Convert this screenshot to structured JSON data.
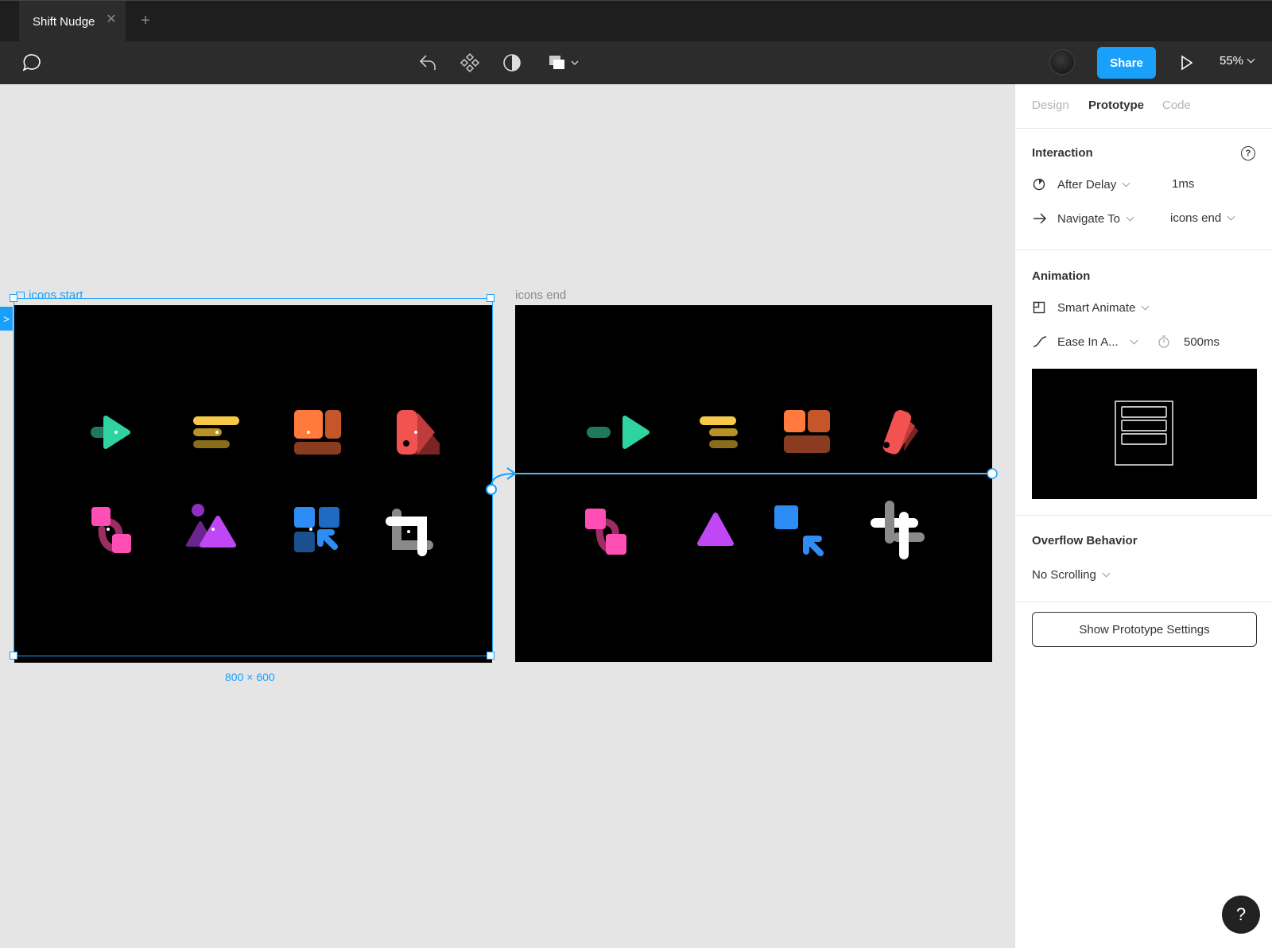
{
  "tabs": {
    "active_tab": "Shift Nudge",
    "close_glyph": "✕",
    "add_glyph": "+"
  },
  "toolbar": {
    "comment_icon": "comment-icon",
    "center_icons": [
      "back-icon",
      "component-icon",
      "mask-contrast-icon",
      "boolean-shapes-icon"
    ],
    "share_label": "Share",
    "zoom_label": "55%"
  },
  "canvas": {
    "frame_start_label": "icons start",
    "frame_end_label": "icons end",
    "dimensions": "800 × 600",
    "flow_start_glyph": ">"
  },
  "panel": {
    "tabs": [
      "Design",
      "Prototype",
      "Code"
    ],
    "active_tab": "Prototype",
    "interaction": {
      "title": "Interaction",
      "help_glyph": "?",
      "trigger": "After Delay",
      "delay": "1ms",
      "action": "Navigate To",
      "destination": "icons end"
    },
    "animation": {
      "title": "Animation",
      "type": "Smart Animate",
      "easing": "Ease In A...",
      "duration": "500ms"
    },
    "overflow": {
      "title": "Overflow Behavior",
      "value": "No Scrolling"
    },
    "settings_button": "Show Prototype Settings"
  },
  "help_fab": "?",
  "colors": {
    "accent": "#18a0fb",
    "green": "#2ed3a0",
    "yellow": "#f7c948",
    "orange": "#ff7a3c",
    "red": "#f25250",
    "pink": "#ff4fb4",
    "purple": "#c147f5",
    "blue": "#2e8cf5",
    "white": "#ffffff"
  }
}
